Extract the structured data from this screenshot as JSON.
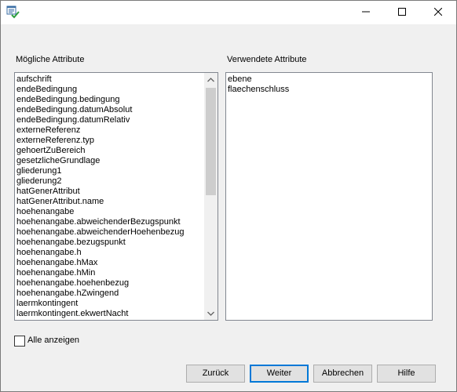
{
  "window": {
    "icons": {
      "app": "list-check-icon",
      "minimize": "minimize-icon",
      "maximize": "maximize-icon",
      "close": "close-icon"
    }
  },
  "available": {
    "label": "Mögliche Attribute",
    "items": [
      "aufschrift",
      "endeBedingung",
      "endeBedingung.bedingung",
      "endeBedingung.datumAbsolut",
      "endeBedingung.datumRelativ",
      "externeReferenz",
      "externeReferenz.typ",
      "gehoertZuBereich",
      "gesetzlicheGrundlage",
      "gliederung1",
      "gliederung2",
      "hatGenerAttribut",
      "hatGenerAttribut.name",
      "hoehenangabe",
      "hoehenangabe.abweichenderBezugspunkt",
      "hoehenangabe.abweichenderHoehenbezug",
      "hoehenangabe.bezugspunkt",
      "hoehenangabe.h",
      "hoehenangabe.hMax",
      "hoehenangabe.hMin",
      "hoehenangabe.hoehenbezug",
      "hoehenangabe.hZwingend",
      "laermkontingent",
      "laermkontingent.ekwertNacht"
    ]
  },
  "used": {
    "label": "Verwendete Attribute",
    "items": [
      "ebene",
      "flaechenschluss"
    ]
  },
  "show_all": {
    "label": "Alle anzeigen",
    "checked": false
  },
  "buttons": {
    "back": "Zurück",
    "next": "Weiter",
    "cancel": "Abbrechen",
    "help": "Hilfe"
  },
  "colors": {
    "accent": "#0078d7",
    "check_green": "#2e9e3e"
  }
}
